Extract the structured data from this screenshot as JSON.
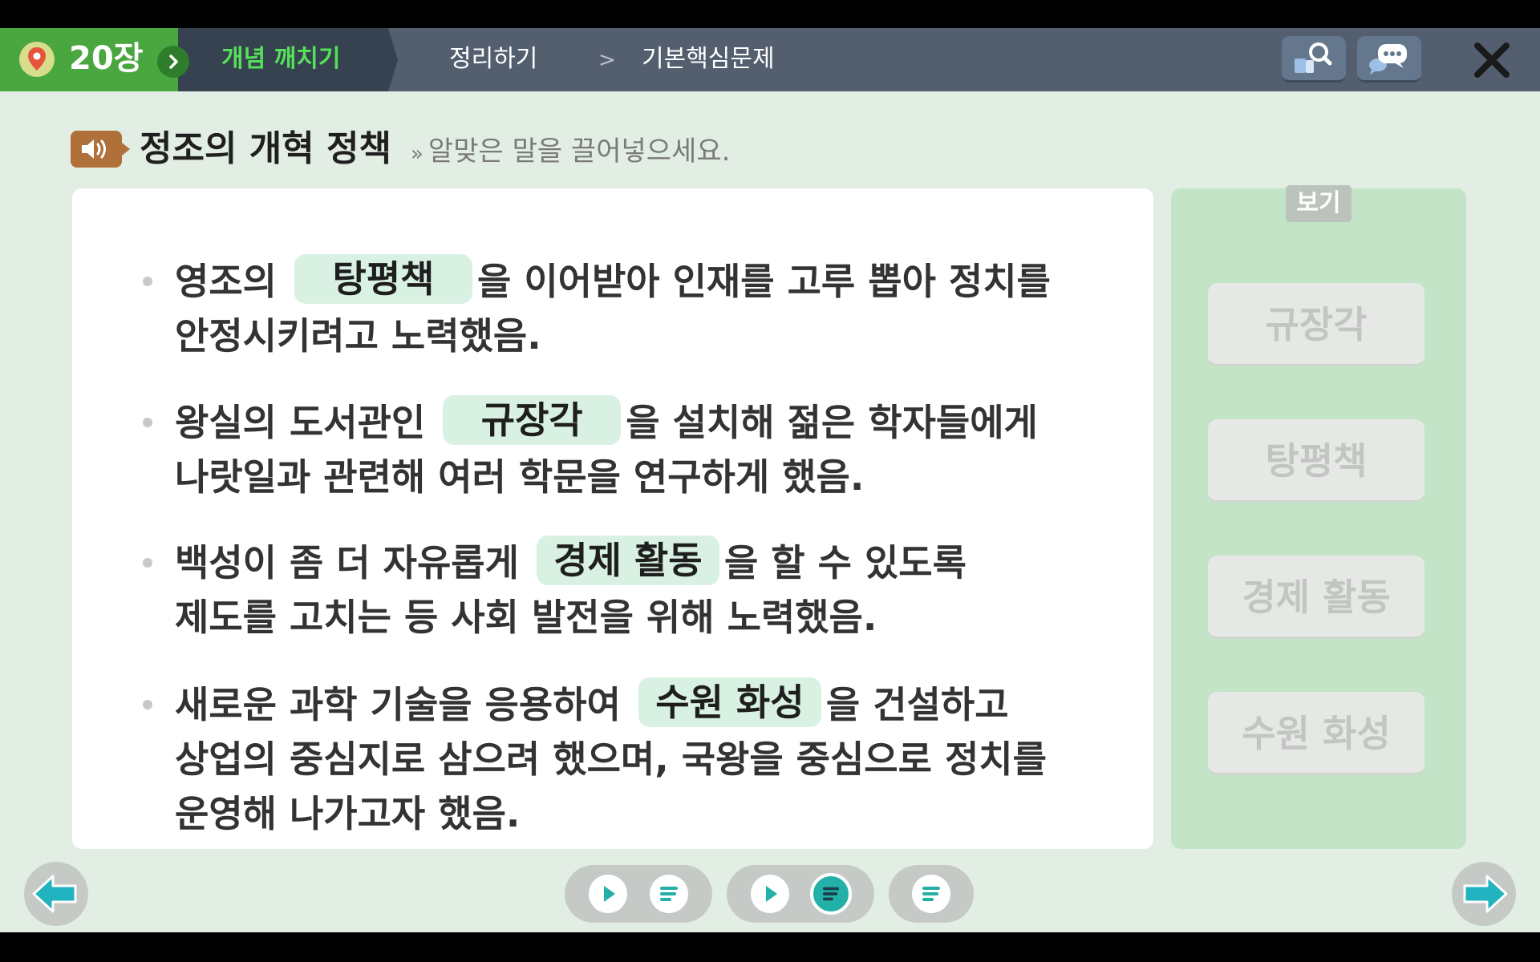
{
  "colors": {
    "topbar": "#535f6f",
    "chapter_green": "#4aa63f",
    "active_tab_text": "#55e05a",
    "app_background": "#e2ede3",
    "blank_fill": "#d9f1e3",
    "choices_panel": "#c4e4c7",
    "accent_teal": "#22b0a8"
  },
  "header": {
    "chapter": "20장",
    "tabs": [
      {
        "label": "개념 깨치기",
        "active": true
      },
      {
        "label": "정리하기",
        "active": false
      },
      {
        "label": "기본핵심문제",
        "active": false
      }
    ],
    "separator": ">",
    "icons": {
      "chapter": "map-pin-icon",
      "chapter_next": "chevron-right-icon",
      "search": "search-book-icon",
      "chat": "chat-bubble-icon",
      "close": "close-icon"
    }
  },
  "title": {
    "speaker_icon": "speaker-icon",
    "text": "정조의 개혁 정책",
    "instruction_mark": "»",
    "instruction": "알맞은 말을 끌어넣으세요."
  },
  "items": [
    {
      "line1_before": "영조의",
      "blank": "탕평책",
      "line1_after": "을 이어받아 인재를 고루 뽑아 정치를",
      "line2": "안정시키려고 노력했음."
    },
    {
      "line1_before": "왕실의 도서관인",
      "blank": "규장각",
      "line1_after": "을 설치해 젊은 학자들에게",
      "line2": "나랏일과 관련해 여러 학문을 연구하게 했음."
    },
    {
      "line1_before": "백성이 좀 더 자유롭게",
      "blank": "경제 활동",
      "line1_after": "을 할 수 있도록",
      "line2": "제도를 고치는 등 사회 발전을 위해 노력했음."
    },
    {
      "line1_before": "새로운 과학 기술을 응용하여",
      "blank": "수원 화성",
      "line1_after": "을 건설하고",
      "line2": "상업의 중심지로 삼으려 했으며, 국왕을 중심으로 정치를",
      "line3": "운영해 나가고자 했음."
    }
  ],
  "choices": {
    "label": "보기",
    "options": [
      "규장각",
      "탕평책",
      "경제 활동",
      "수원 화성"
    ]
  },
  "footer": {
    "prev_icon": "arrow-left-icon",
    "next_icon": "arrow-right-icon",
    "media_groups": [
      {
        "buttons": [
          "play-icon",
          "script-icon"
        ],
        "active": null
      },
      {
        "buttons": [
          "play-icon",
          "script-icon"
        ],
        "active": "script-icon"
      },
      {
        "buttons": [
          "script-icon"
        ],
        "active": null
      }
    ]
  }
}
